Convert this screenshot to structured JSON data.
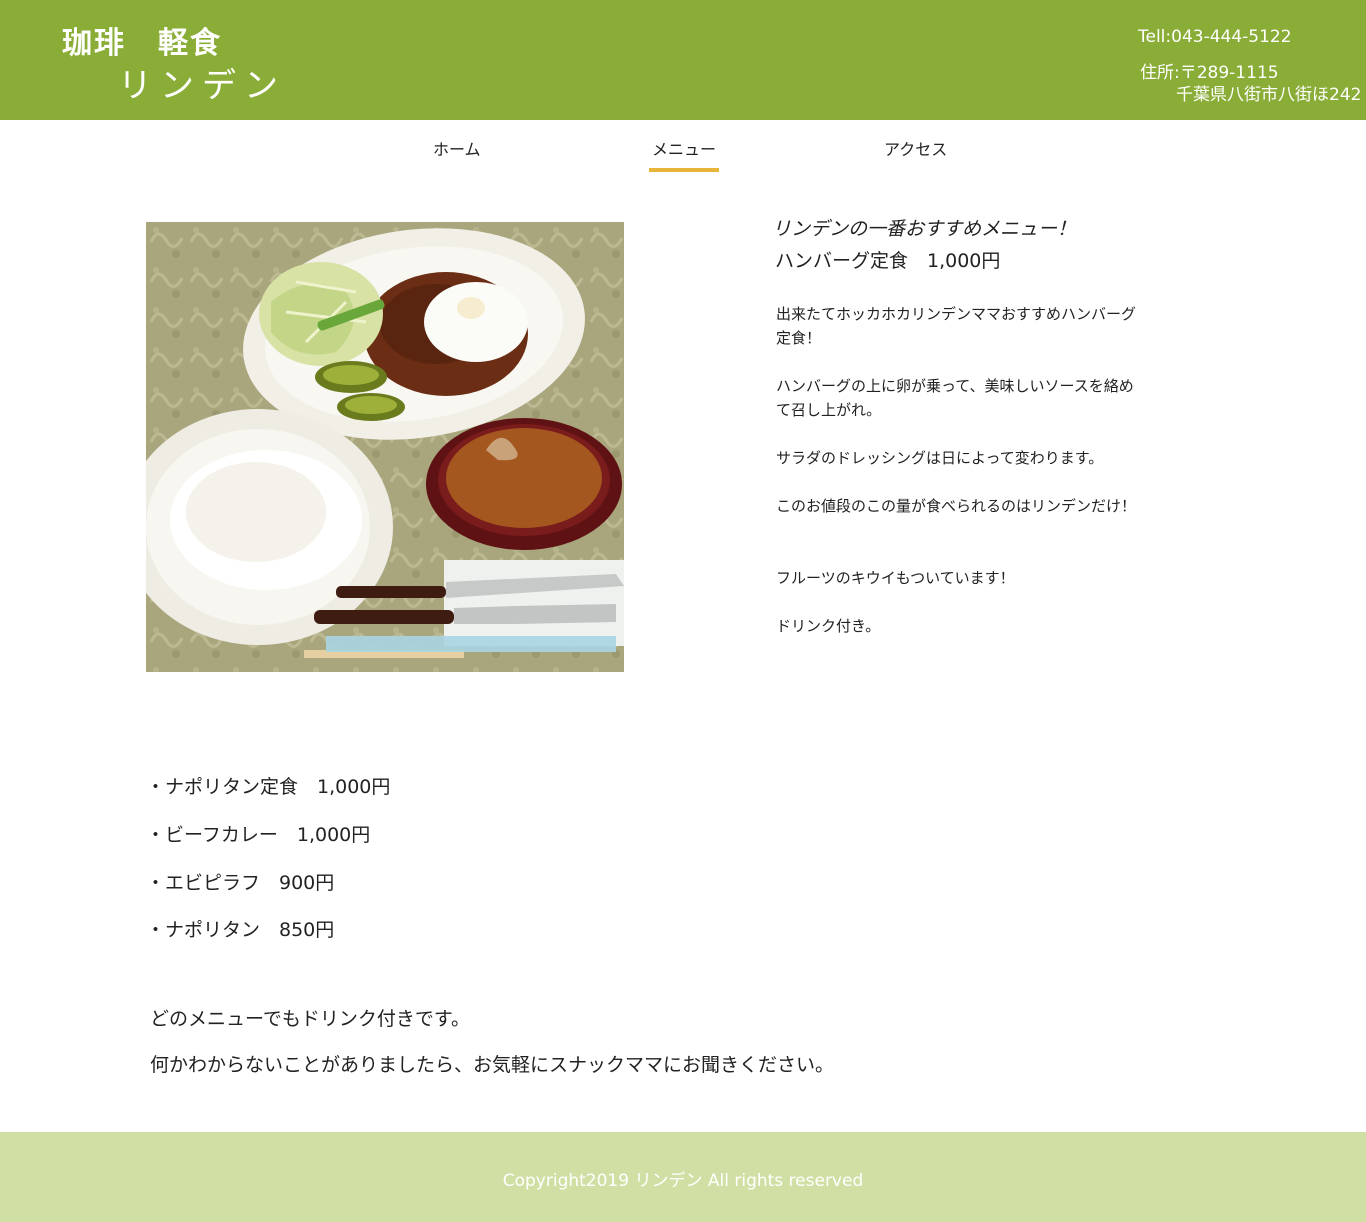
{
  "header": {
    "logo_line1": "珈琲　軽食",
    "logo_line2": "リンデン",
    "tel": "Tell:043-444-5122",
    "address_label": "住所:〒289-1115",
    "address_line": "千葉県八街市八街ほ242",
    "background_color": "#8aad37"
  },
  "nav": {
    "items": [
      {
        "label": "ホーム"
      },
      {
        "label": "メニュー",
        "active": true
      },
      {
        "label": "アクセス"
      }
    ],
    "active_underline_color": "#e8b43a"
  },
  "featured": {
    "kicker": "リンデンの一番おすすめメニュー！",
    "title": "ハンバーグ定食　1,000円",
    "paragraphs": [
      "出来たてホッカホカリンデンママおすすめハンバーグ定食！",
      "ハンバーグの上に卵が乗って、美味しいソースを絡めて召し上がれ。",
      "サラダのドレッシングは日によって変わります。",
      "このお値段のこの量が食べられるのはリンデンだけ！",
      "フルーツのキウイもついています！",
      "ドリンク付き。"
    ]
  },
  "menu": {
    "items": [
      "・ナポリタン定食　1,000円",
      "・ビーフカレー　1,000円",
      "・エビピラフ　900円",
      "・ナポリタン　850円"
    ]
  },
  "notes": [
    "どのメニューでもドリンク付きです。",
    "何かわからないことがありましたら、お気軽にスナックママにお聞きください。"
  ],
  "footer": {
    "copyright": "Copyright2019 リンデン All rights reserved",
    "background_color": "#d0e0a4"
  }
}
